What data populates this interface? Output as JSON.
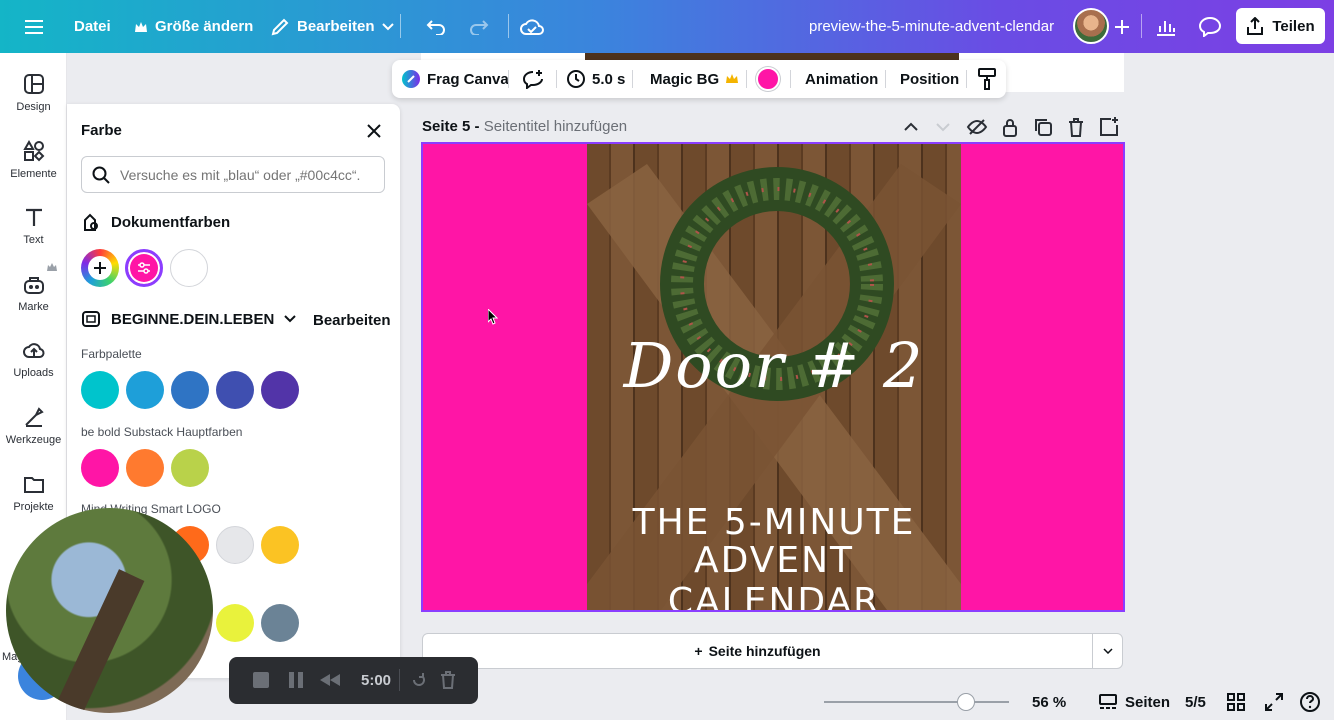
{
  "topbar": {
    "file_label": "Datei",
    "resize_label": "Größe ändern",
    "edit_label": "Bearbeiten",
    "document_title": "preview-the-5-minute-advent-clendar",
    "share_label": "Teilen"
  },
  "sidebar": {
    "items": [
      {
        "label": "Design",
        "icon": "layout-icon"
      },
      {
        "label": "Elemente",
        "icon": "elements-icon"
      },
      {
        "label": "Text",
        "icon": "text-icon"
      },
      {
        "label": "Marke",
        "icon": "brand-icon"
      },
      {
        "label": "Uploads",
        "icon": "upload-cloud-icon"
      },
      {
        "label": "Werkzeuge",
        "icon": "tools-icon"
      },
      {
        "label": "Projekte",
        "icon": "folder-icon"
      }
    ],
    "magic_label": "Mag"
  },
  "color_panel": {
    "title": "Farbe",
    "search_placeholder": "Versuche es mit „blau“ oder „#00c4cc“.",
    "document_colors_heading": "Dokumentfarben",
    "document_colors": [
      "#ff15a6",
      "#ffffff"
    ],
    "brand_kit_name": "BEGINNE.DEIN.LEBEN",
    "brand_kit_edit": "Bearbeiten",
    "palettes": [
      {
        "label": "Farbpalette",
        "colors": [
          "#00c4cc",
          "#1e9fd9",
          "#2f74c4",
          "#3f4fb0",
          "#5234a8"
        ]
      },
      {
        "label": "be bold Substack Hauptfarben",
        "colors": [
          "#ff15a6",
          "#ff7a2f",
          "#b9d24a"
        ]
      },
      {
        "label": "Mind Writing Smart LOGO",
        "colors": [
          "#ff6a1a",
          "#e6e7ea",
          "#fbc323"
        ]
      },
      {
        "label": "",
        "colors": [
          "#e9f23c",
          "#6b8396"
        ]
      }
    ]
  },
  "context_toolbar": {
    "ask_canva": "Frag Canva",
    "duration": "5.0 s",
    "magic_bg": "Magic BG",
    "fill_color": "#ff15a6",
    "animation": "Animation",
    "position": "Position"
  },
  "page": {
    "page_label": "Seite 5 -",
    "page_title_placeholder": "Seitentitel hinzufügen"
  },
  "design": {
    "headline": "Door # 2",
    "line1": "THE 5-MINUTE",
    "line2": "ADVENT CALENDAR",
    "background_color": "#ff15a6"
  },
  "add_page_label": "Seite hinzufügen",
  "bottom_bar": {
    "zoom": "56 %",
    "zoom_level": 0.56,
    "pages_label": "Seiten",
    "page_counter": "5/5"
  },
  "recorder": {
    "time": "5:00"
  }
}
